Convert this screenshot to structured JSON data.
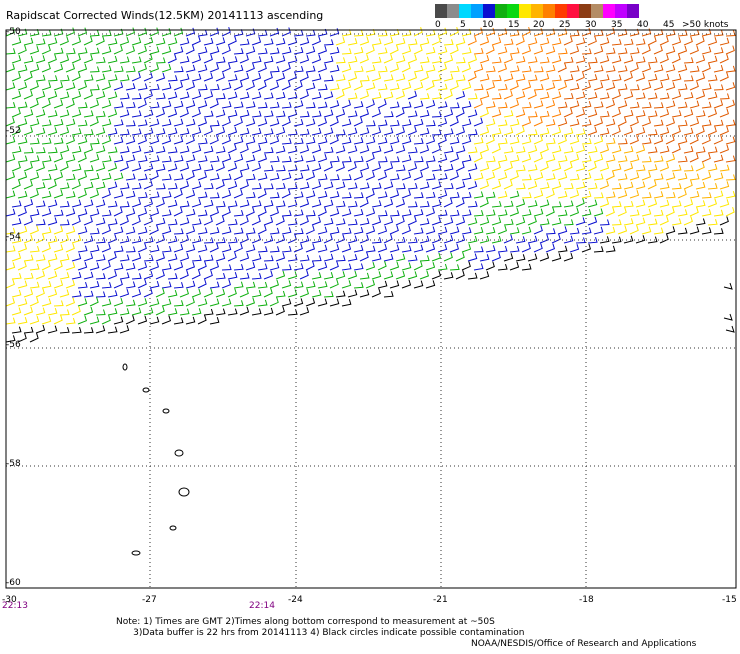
{
  "title": "Rapidscat Corrected Winds(12.5KM) 20141113 ascending",
  "legend": {
    "colors": [
      "#4a4a4a",
      "#8c8c8c",
      "#00d8ff",
      "#00a0ff",
      "#0a10d0",
      "#10b010",
      "#0ad810",
      "#ffe800",
      "#ffb400",
      "#ff8000",
      "#ff3c00",
      "#ff1040",
      "#8c3c14",
      "#b48c64",
      "#ff00ff",
      "#c000ff",
      "#7800c8"
    ],
    "labels": [
      "0",
      "5",
      "10",
      "15",
      "20",
      "25",
      "30",
      "35",
      "40",
      "45",
      ">50 knots"
    ]
  },
  "lon_labels": [
    "-30",
    "-27",
    "-24",
    "-21",
    "-18",
    "-15"
  ],
  "lat_labels": [
    "-50",
    "-52",
    "-54",
    "-56",
    "-58",
    "-60"
  ],
  "time_labels": [
    "22:13",
    "22:14"
  ],
  "notes": [
    "Note: 1) Times are GMT 2)Times along bottom correspond to measurement at ~50S",
    "      3)Data buffer is 22 hrs from 20141113 4) Black circles indicate possible contamination"
  ],
  "credit": "NOAA/NESDIS/Office of Research and Applications",
  "map": {
    "lon_range": [
      -30,
      -15
    ],
    "lat_range": [
      -60,
      -50
    ],
    "speed_unit": "knots"
  }
}
